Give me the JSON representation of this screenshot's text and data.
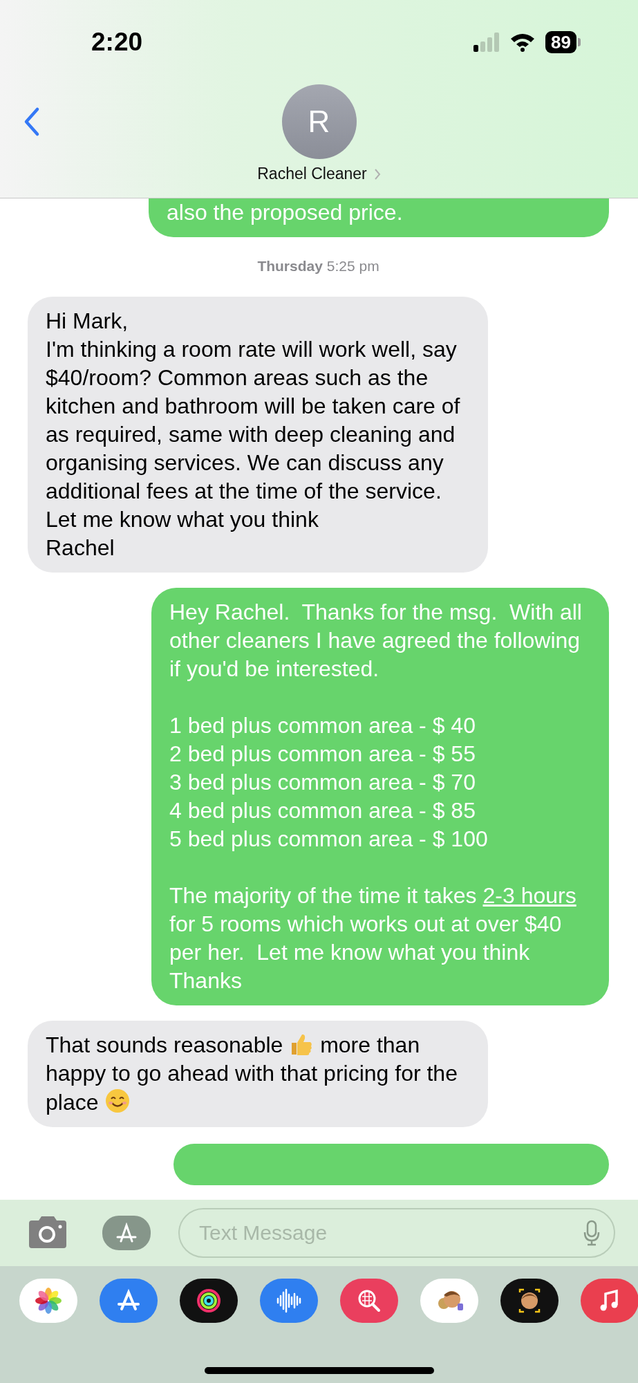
{
  "status_bar": {
    "time": "2:20",
    "battery": "89"
  },
  "header": {
    "avatar_initial": "R",
    "contact_name": "Rachel Cleaner"
  },
  "messages": [
    {
      "kind": "sent",
      "parts": [
        {
          "kind": "text",
          "text": "also the proposed price."
        }
      ]
    },
    {
      "kind": "timestamp",
      "text": "**Thursday** 5:25 pm"
    },
    {
      "kind": "received",
      "parts": [
        {
          "kind": "text",
          "text": "Hi Mark,\nI'm thinking a room rate will work well, say $40/room? Common areas such as the kitchen and bathroom will be taken care of as required, same with deep cleaning and organising services. We can discuss any additional fees at the time of the service. Let me know what you think\nRachel"
        }
      ]
    },
    {
      "kind": "sent",
      "parts": [
        {
          "kind": "text",
          "text": "Hey Rachel.  Thanks for the msg.  With all other cleaners I have agreed the following if you'd be interested.\n\n1 bed plus common area - $ 40\n2 bed plus common area - $ 55\n3 bed plus common area - $ 70\n4 bed plus common area - $ 85\n5 bed plus common area - $ 100\n\nThe majority of the time it takes "
        },
        {
          "kind": "link",
          "text": "2-3 hours"
        },
        {
          "kind": "text",
          "text": " for 5 rooms which works out at over $40 per her.  Let me know what you think\nThanks"
        }
      ]
    },
    {
      "kind": "received",
      "parts": [
        {
          "kind": "text",
          "text": "That sounds reasonable "
        },
        {
          "kind": "thumbs-up"
        },
        {
          "kind": "text",
          "text": " more than happy to go ahead with that pricing for the place "
        },
        {
          "kind": "smile"
        }
      ]
    },
    {
      "kind": "sent"
    }
  ],
  "composer": {
    "placeholder": "Text Message"
  }
}
